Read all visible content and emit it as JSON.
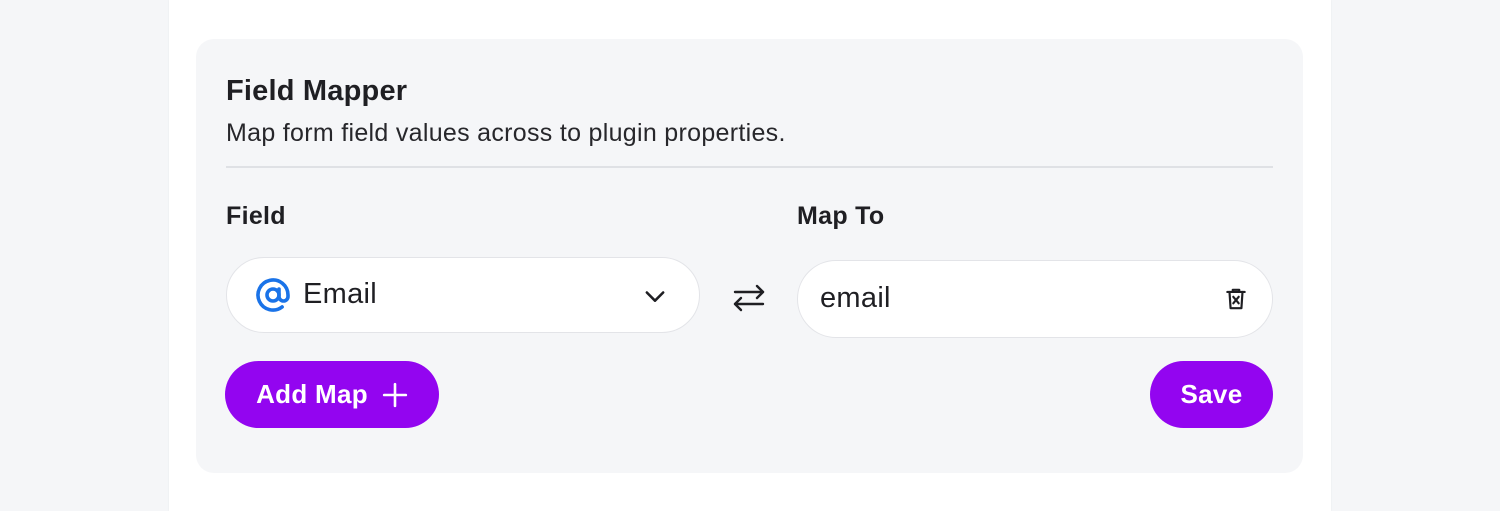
{
  "panel": {
    "title": "Field Mapper",
    "subtitle": "Map form field values across to plugin properties."
  },
  "columns": {
    "field_label": "Field",
    "mapto_label": "Map To"
  },
  "field_select": {
    "value": "Email",
    "icon": "at-sign-icon"
  },
  "mapto": {
    "value": "email",
    "icon": "trash-icon"
  },
  "buttons": {
    "add_map_label": "Add Map",
    "save_label": "Save"
  },
  "colors": {
    "accent": "#9305f0",
    "at_icon": "#1a73e8",
    "panel_bg": "#f5f6f8"
  }
}
